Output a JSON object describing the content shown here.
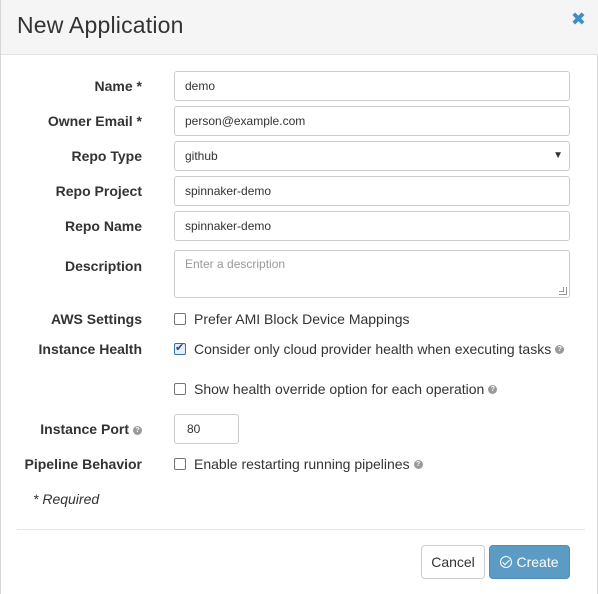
{
  "dialog": {
    "title": "New Application",
    "close_icon": "close-icon"
  },
  "fields": {
    "name": {
      "label": "Name *",
      "value": "demo"
    },
    "owner_email": {
      "label": "Owner Email *",
      "value": "person@example.com"
    },
    "repo_type": {
      "label": "Repo Type",
      "value": "github"
    },
    "repo_project": {
      "label": "Repo Project",
      "value": "spinnaker-demo"
    },
    "repo_name": {
      "label": "Repo Name",
      "value": "spinnaker-demo"
    },
    "description": {
      "label": "Description",
      "value": "",
      "placeholder": "Enter a description"
    },
    "aws_settings": {
      "label": "AWS Settings",
      "option": "Prefer AMI Block Device Mappings",
      "checked": false
    },
    "instance_health": {
      "label": "Instance Health",
      "option1": "Consider only cloud provider health when executing tasks",
      "option1_checked": true,
      "option2": "Show health override option for each operation",
      "option2_checked": false
    },
    "instance_port": {
      "label": "Instance Port",
      "value": "80"
    },
    "pipeline_behavior": {
      "label": "Pipeline Behavior",
      "option": "Enable restarting running pipelines",
      "checked": false
    }
  },
  "required_note": "* Required",
  "buttons": {
    "cancel": "Cancel",
    "create": "Create"
  },
  "icons": {
    "help": "?",
    "select_caret": "▼",
    "close": "✖"
  },
  "colors": {
    "primary": "#5b9bc4",
    "link": "#3a8fc8"
  }
}
